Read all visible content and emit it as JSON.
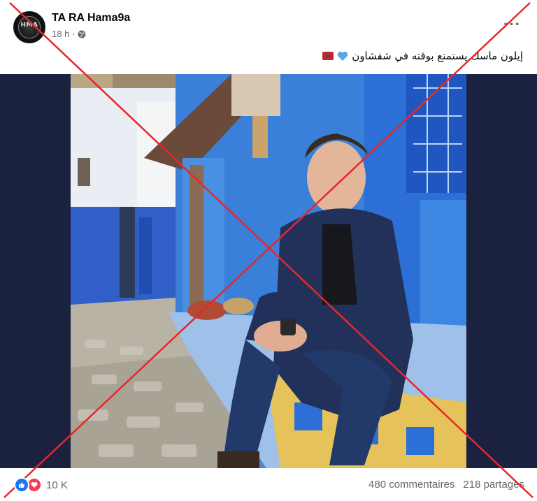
{
  "post": {
    "author": "TA RA Hama9a",
    "avatar_text": "HMA",
    "time": "18 h ·",
    "caption": "إيلون ماسك يستمتع بوقته في شفشاون"
  },
  "footer": {
    "reaction_count": "10 K",
    "comments": "480 commentaires",
    "shares": "218 partages"
  },
  "icons": {
    "globe": "globe-icon",
    "more": "more-options-icon",
    "heart": "blue-heart-icon",
    "flag": "morocco-flag-icon",
    "like": "like-reaction-icon",
    "love": "love-reaction-icon"
  },
  "colors": {
    "cross": "#e8262b",
    "media_bg": "#1b2240",
    "like": "#1877f2",
    "love": "#f33e58",
    "secondary_text": "#65676b"
  }
}
